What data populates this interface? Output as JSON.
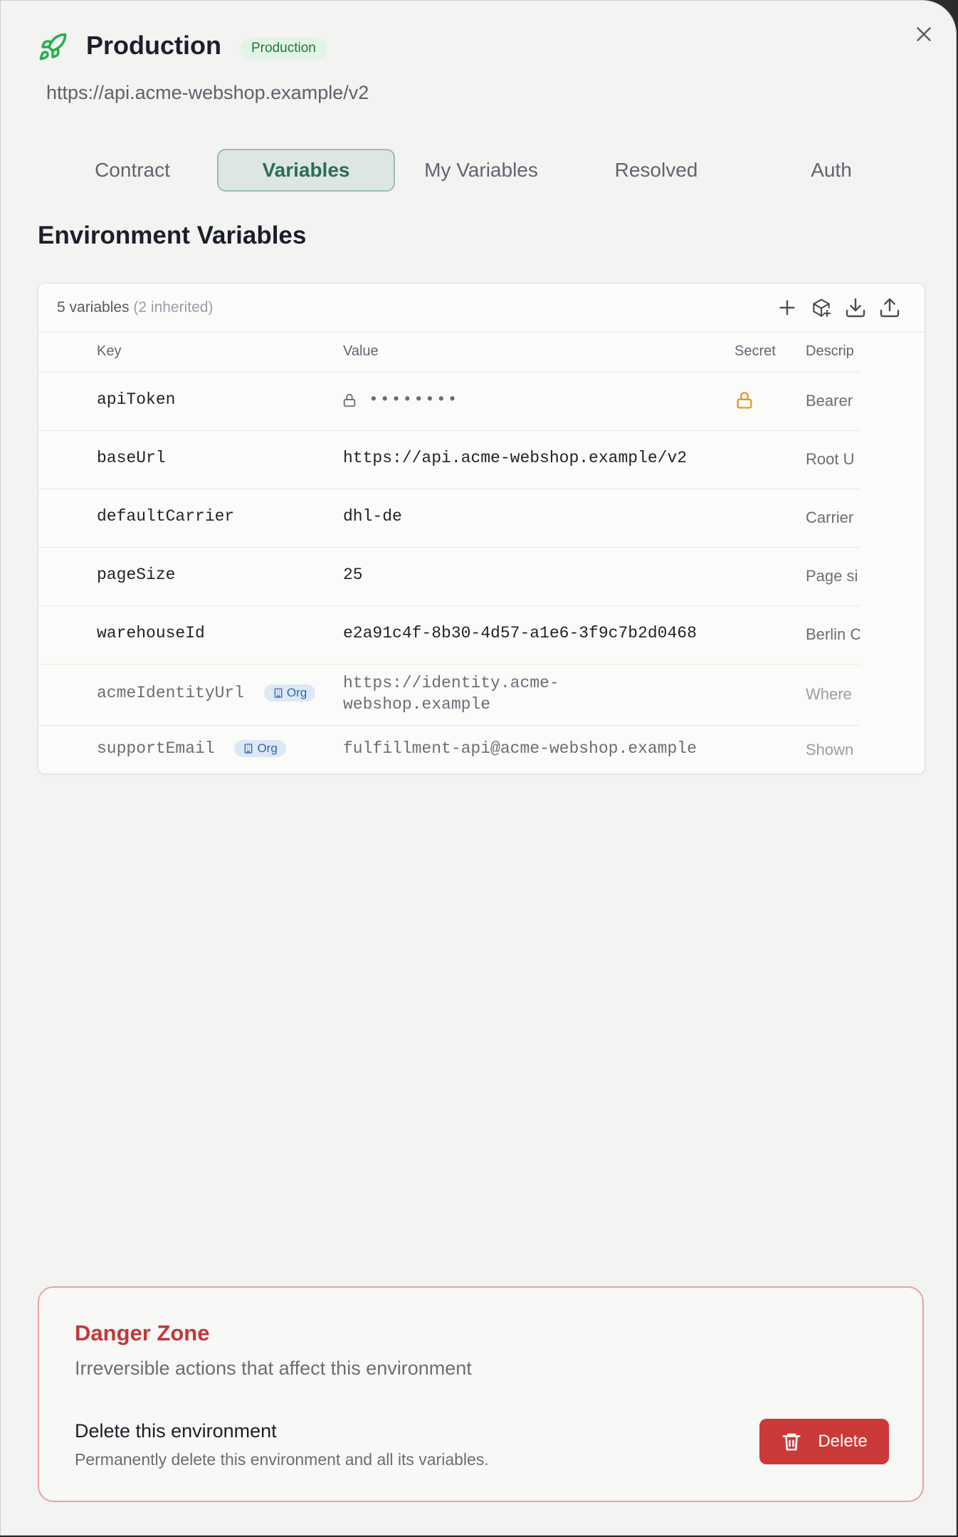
{
  "header": {
    "title": "Production",
    "badge": "Production",
    "url": "https://api.acme-webshop.example/v2"
  },
  "tabs": [
    {
      "label": "Contract",
      "active": false
    },
    {
      "label": "Variables",
      "active": true
    },
    {
      "label": "My Variables",
      "active": false
    },
    {
      "label": "Resolved",
      "active": false
    },
    {
      "label": "Auth",
      "active": false
    }
  ],
  "section_title": "Environment Variables",
  "variables_card": {
    "count_label": "5 variables",
    "inherited_label": "(2 inherited)",
    "tools": [
      "plus-icon",
      "package-plus-icon",
      "download-icon",
      "upload-icon"
    ],
    "columns": {
      "key": "Key",
      "value": "Value",
      "secret": "Secret",
      "description": "Descrip"
    },
    "rows": [
      {
        "key": "apiToken",
        "value": "••••••••",
        "masked": true,
        "secret": true,
        "description": "Bearer",
        "inherited": false
      },
      {
        "key": "baseUrl",
        "value": "https://api.acme-webshop.example/v2",
        "masked": false,
        "secret": false,
        "description": "Root U",
        "inherited": false
      },
      {
        "key": "defaultCarrier",
        "value": "dhl-de",
        "masked": false,
        "secret": false,
        "description": "Carrier",
        "inherited": false
      },
      {
        "key": "pageSize",
        "value": "25",
        "masked": false,
        "secret": false,
        "description": "Page si",
        "inherited": false
      },
      {
        "key": "warehouseId",
        "value": "e2a91c4f-8b30-4d57-a1e6-3f9c7b2d0468",
        "masked": false,
        "secret": false,
        "description": "Berlin C",
        "inherited": false
      },
      {
        "key": "acmeIdentityUrl",
        "badge": "Org",
        "value": "https://identity.acme-webshop.example",
        "masked": false,
        "secret": false,
        "description": "Where",
        "inherited": true
      },
      {
        "key": "supportEmail",
        "badge": "Org",
        "value": "fulfillment-api@acme-webshop.example",
        "masked": false,
        "secret": false,
        "description": "Shown",
        "inherited": true
      }
    ]
  },
  "danger_zone": {
    "title": "Danger Zone",
    "subtitle": "Irreversible actions that affect this environment",
    "item_title": "Delete this environment",
    "item_description": "Permanently delete this environment and all its variables.",
    "delete_label": "Delete"
  },
  "colors": {
    "accent": "#2a6d5a",
    "danger": "#cb3a38",
    "badge_green": "#1c7a3c",
    "secret_lock": "#e09a2a",
    "org_badge": "#2f66b0"
  }
}
